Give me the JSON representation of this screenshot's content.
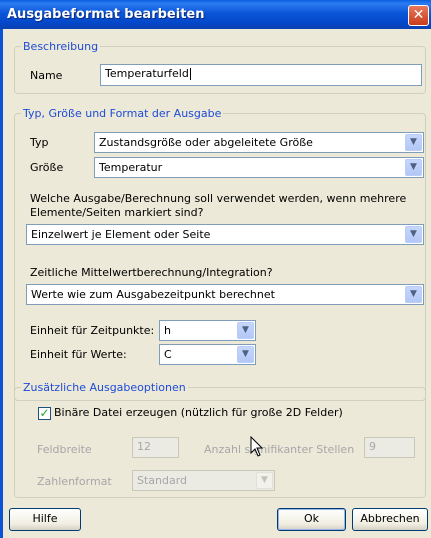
{
  "window": {
    "title": "Ausgabeformat bearbeiten",
    "close_glyph": "✕"
  },
  "beschreibung": {
    "legend": "Beschreibung",
    "name_label": "Name",
    "name_value": "Temperaturfeld"
  },
  "typ_group": {
    "legend": "Typ, Größe und Format der Ausgabe",
    "typ_label": "Typ",
    "typ_value": "Zustandsgröße oder abgeleitete Größe",
    "groesse_label": "Größe",
    "groesse_value": "Temperatur",
    "question_line1": "Welche Ausgabe/Berechnung soll verwendet werden, wenn mehrere",
    "question_line2": "Elemente/Seiten markiert sind?",
    "auswahl_value": "Einzelwert je Element oder Seite",
    "zeit_question": "Zeitliche Mittelwertberechnung/Integration?",
    "zeit_value": "Werte wie zum Ausgabezeitpunkt berechnet",
    "einheit_zeit_label": "Einheit für Zeitpunkte:",
    "einheit_zeit_value": "h",
    "einheit_werte_label": "Einheit für Werte:",
    "einheit_werte_value": "C"
  },
  "optionen": {
    "legend": "Zusätzliche Ausgabeoptionen",
    "binary_label": "Binäre Datei erzeugen (nützlich für große 2D Felder)",
    "binary_checked": true,
    "feldbreite_label": "Feldbreite",
    "feldbreite_value": "12",
    "stellen_label": "Anzahl signifikanter Stellen",
    "stellen_value": "9",
    "zahlenformat_label": "Zahlenformat",
    "zahlenformat_value": "Standard"
  },
  "buttons": {
    "help": "Hilfe",
    "ok": "Ok",
    "cancel": "Abbrechen"
  },
  "icons": {
    "dropdown": "▼",
    "check": "✓"
  },
  "colors": {
    "titlebar": "#0a56d8",
    "legend": "#1d4bd8",
    "checkmark": "#21a121"
  }
}
